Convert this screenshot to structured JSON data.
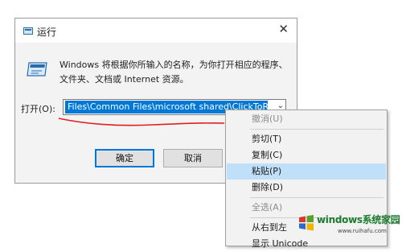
{
  "dialog": {
    "title": "运行",
    "description_line1": "Windows 将根据你所输入的名称，为你打开相应的程序、",
    "description_line2": "文件夹、文档或 Internet 资源。",
    "open_label": "打开(O):",
    "open_value": "Files\\Common Files\\microsoft shared\\ClickToRun",
    "ok_label": "确定",
    "cancel_label": "取消"
  },
  "context_menu": {
    "items": [
      {
        "label": "撤消(U)",
        "state": "disabled"
      },
      {
        "label": "剪切(T)",
        "state": "normal"
      },
      {
        "label": "复制(C)",
        "state": "normal"
      },
      {
        "label": "粘贴(P)",
        "state": "highlighted"
      },
      {
        "label": "删除(D)",
        "state": "normal"
      },
      {
        "label": "全选(A)",
        "state": "disabled"
      },
      {
        "label": "从右到左",
        "state": "normal"
      },
      {
        "label": "显示 Unicode",
        "state": "normal"
      }
    ]
  },
  "watermark": {
    "text": "windows系统家园",
    "subtext": "www.ruihafu.com"
  },
  "colors": {
    "selection": "#0078d7",
    "menu_highlight": "#bfe0f8",
    "annotation_underline": "#e02020",
    "watermark_green": "#1d7a2f"
  }
}
